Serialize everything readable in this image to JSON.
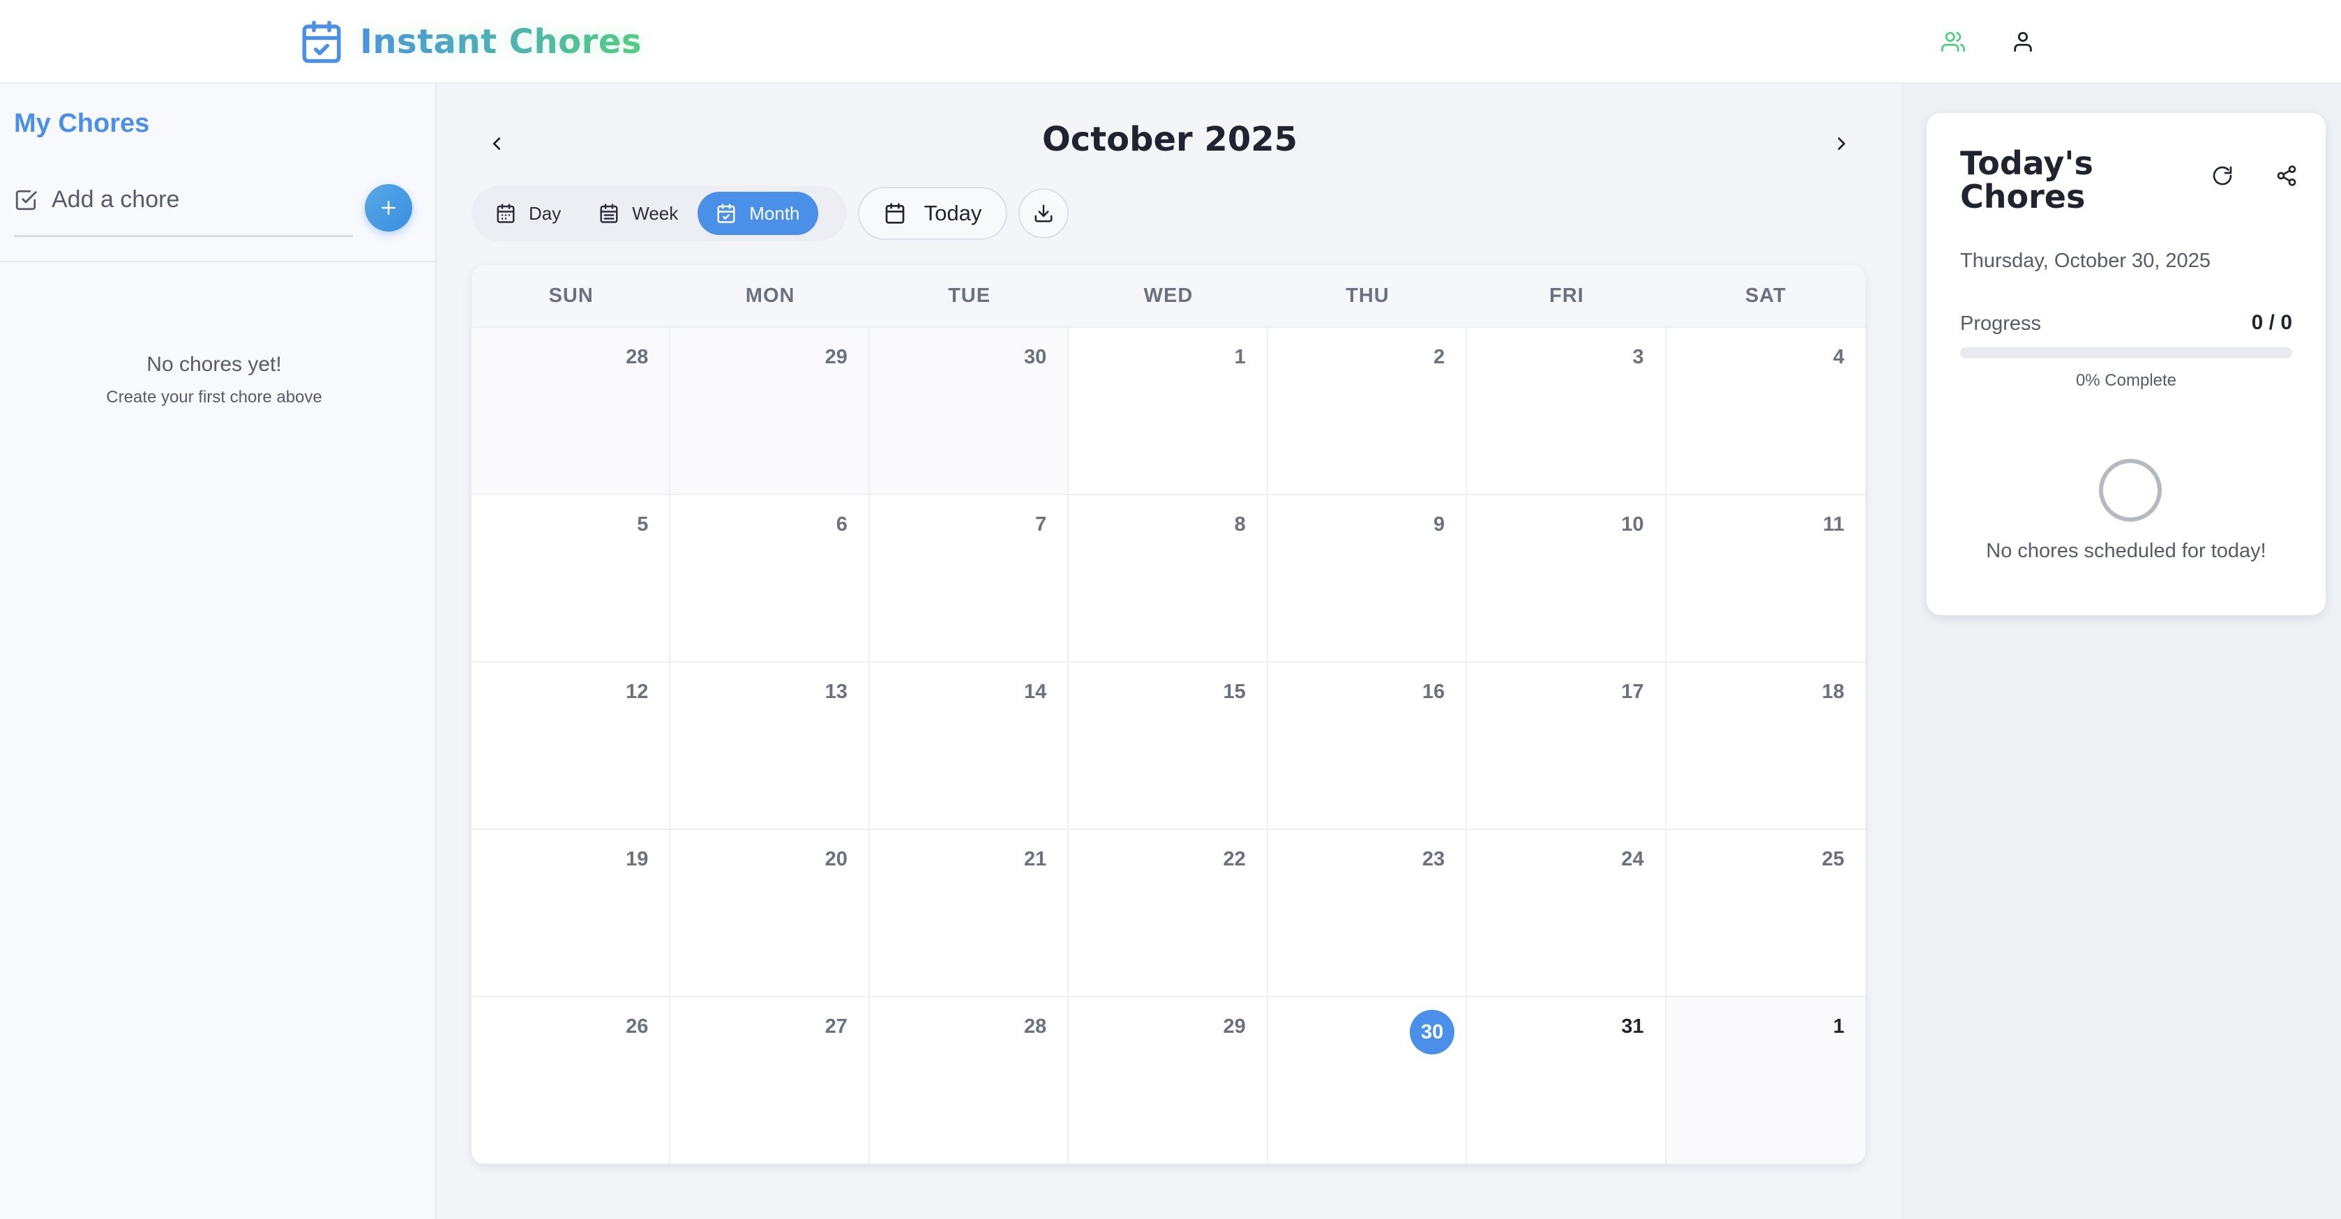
{
  "app": {
    "title": "Instant Chores",
    "brand_colors": [
      "#4a8fe8",
      "#4fcf82"
    ]
  },
  "header": {
    "icons": [
      "users-icon",
      "user-icon"
    ]
  },
  "sidebar": {
    "title": "My Chores",
    "add_placeholder": "Add a chore",
    "empty_title": "No chores yet!",
    "empty_subtitle": "Create your first chore above"
  },
  "calendar": {
    "month_title": "October 2025",
    "views": [
      {
        "label": "Day",
        "icon": "calendar-icon",
        "active": false
      },
      {
        "label": "Week",
        "icon": "calendar-week-icon",
        "active": false
      },
      {
        "label": "Month",
        "icon": "calendar-check-icon",
        "active": true
      }
    ],
    "today_label": "Today",
    "weekdays": [
      "SUN",
      "MON",
      "TUE",
      "WED",
      "THU",
      "FRI",
      "SAT"
    ],
    "days": [
      {
        "n": "28",
        "other": true
      },
      {
        "n": "29",
        "other": true
      },
      {
        "n": "30",
        "other": true
      },
      {
        "n": "1"
      },
      {
        "n": "2"
      },
      {
        "n": "3"
      },
      {
        "n": "4"
      },
      {
        "n": "5"
      },
      {
        "n": "6"
      },
      {
        "n": "7"
      },
      {
        "n": "8"
      },
      {
        "n": "9"
      },
      {
        "n": "10"
      },
      {
        "n": "11"
      },
      {
        "n": "12"
      },
      {
        "n": "13"
      },
      {
        "n": "14"
      },
      {
        "n": "15"
      },
      {
        "n": "16"
      },
      {
        "n": "17"
      },
      {
        "n": "18"
      },
      {
        "n": "19"
      },
      {
        "n": "20"
      },
      {
        "n": "21"
      },
      {
        "n": "22"
      },
      {
        "n": "23"
      },
      {
        "n": "24"
      },
      {
        "n": "25"
      },
      {
        "n": "26"
      },
      {
        "n": "27"
      },
      {
        "n": "28"
      },
      {
        "n": "29"
      },
      {
        "n": "30",
        "today": true
      },
      {
        "n": "31",
        "future": true
      },
      {
        "n": "1",
        "other": true,
        "future": true
      }
    ],
    "today_color": "#4a8fe8"
  },
  "today_panel": {
    "title": "Today's Chores",
    "date": "Thursday, October 30, 2025",
    "progress_label": "Progress",
    "progress_value": "0 / 0",
    "progress_fraction": 0,
    "progress_text": "0% Complete",
    "empty_text": "No chores scheduled for today!"
  }
}
